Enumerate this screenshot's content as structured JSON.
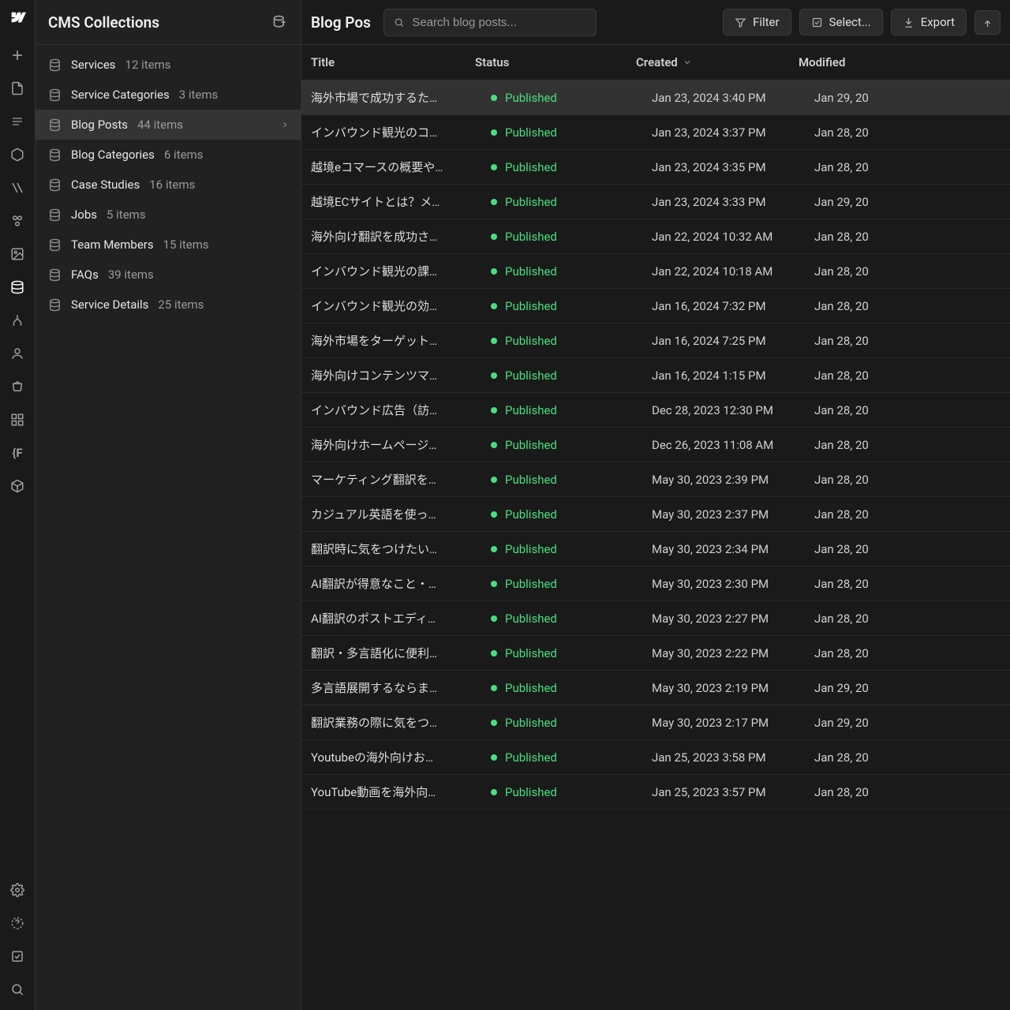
{
  "sidebar_title": "CMS Collections",
  "collections": [
    {
      "label": "Services",
      "count": "12 items"
    },
    {
      "label": "Service Categories",
      "count": "3 items"
    },
    {
      "label": "Blog Posts",
      "count": "44 items",
      "selected": true
    },
    {
      "label": "Blog Categories",
      "count": "6 items"
    },
    {
      "label": "Case Studies",
      "count": "16 items"
    },
    {
      "label": "Jobs",
      "count": "5 items"
    },
    {
      "label": "Team Members",
      "count": "15 items"
    },
    {
      "label": "FAQs",
      "count": "39 items"
    },
    {
      "label": "Service Details",
      "count": "25 items"
    }
  ],
  "main": {
    "title": "Blog Pos",
    "search_placeholder": "Search blog posts...",
    "filter": "Filter",
    "select": "Select...",
    "export": "Export",
    "columns": {
      "title": "Title",
      "status": "Status",
      "created": "Created",
      "modified": "Modified"
    },
    "rows": [
      {
        "title": "海外市場で成功するた…",
        "status": "Published",
        "created": "Jan 23, 2024 3:40 PM",
        "modified": "Jan 29, 20",
        "hover": true
      },
      {
        "title": "インバウンド観光のコ…",
        "status": "Published",
        "created": "Jan 23, 2024 3:37 PM",
        "modified": "Jan 28, 20"
      },
      {
        "title": "越境eコマースの概要や…",
        "status": "Published",
        "created": "Jan 23, 2024 3:35 PM",
        "modified": "Jan 28, 20"
      },
      {
        "title": "越境ECサイトとは？メ…",
        "status": "Published",
        "created": "Jan 23, 2024 3:33 PM",
        "modified": "Jan 29, 20"
      },
      {
        "title": "海外向け翻訳を成功さ…",
        "status": "Published",
        "created": "Jan 22, 2024 10:32 AM",
        "modified": "Jan 28, 20"
      },
      {
        "title": "インバウンド観光の課…",
        "status": "Published",
        "created": "Jan 22, 2024 10:18 AM",
        "modified": "Jan 28, 20"
      },
      {
        "title": "インバウンド観光の効…",
        "status": "Published",
        "created": "Jan 16, 2024 7:32 PM",
        "modified": "Jan 28, 20"
      },
      {
        "title": "海外市場をターゲット…",
        "status": "Published",
        "created": "Jan 16, 2024 7:25 PM",
        "modified": "Jan 28, 20"
      },
      {
        "title": "海外向けコンテンツマ…",
        "status": "Published",
        "created": "Jan 16, 2024 1:15 PM",
        "modified": "Jan 28, 20"
      },
      {
        "title": "インバウンド広告（訪…",
        "status": "Published",
        "created": "Dec 28, 2023 12:30 PM",
        "modified": "Jan 28, 20"
      },
      {
        "title": "海外向けホームページ…",
        "status": "Published",
        "created": "Dec 26, 2023 11:08 AM",
        "modified": "Jan 28, 20"
      },
      {
        "title": "マーケティング翻訳を…",
        "status": "Published",
        "created": "May 30, 2023 2:39 PM",
        "modified": "Jan 28, 20"
      },
      {
        "title": "カジュアル英語を使っ…",
        "status": "Published",
        "created": "May 30, 2023 2:37 PM",
        "modified": "Jan 28, 20"
      },
      {
        "title": "翻訳時に気をつけたい…",
        "status": "Published",
        "created": "May 30, 2023 2:34 PM",
        "modified": "Jan 28, 20"
      },
      {
        "title": "AI翻訳が得意なこと・…",
        "status": "Published",
        "created": "May 30, 2023 2:30 PM",
        "modified": "Jan 28, 20"
      },
      {
        "title": "AI翻訳のポストエディ…",
        "status": "Published",
        "created": "May 30, 2023 2:27 PM",
        "modified": "Jan 28, 20"
      },
      {
        "title": "翻訳・多言語化に便利…",
        "status": "Published",
        "created": "May 30, 2023 2:22 PM",
        "modified": "Jan 28, 20"
      },
      {
        "title": "多言語展開するならま…",
        "status": "Published",
        "created": "May 30, 2023 2:19 PM",
        "modified": "Jan 29, 20"
      },
      {
        "title": "翻訳業務の際に気をつ…",
        "status": "Published",
        "created": "May 30, 2023 2:17 PM",
        "modified": "Jan 29, 20"
      },
      {
        "title": "Youtubeの海外向けお…",
        "status": "Published",
        "created": "Jan 25, 2023 3:58 PM",
        "modified": "Jan 28, 20"
      },
      {
        "title": "YouTube動画を海外向…",
        "status": "Published",
        "created": "Jan 25, 2023 3:57 PM",
        "modified": "Jan 28, 20"
      }
    ]
  }
}
